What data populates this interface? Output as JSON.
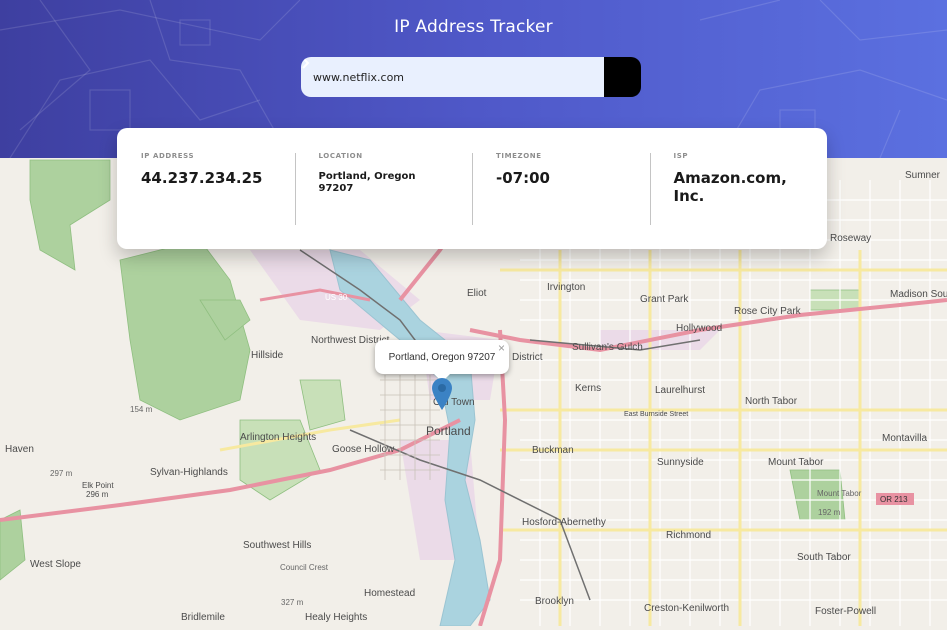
{
  "header": {
    "title": "IP Address Tracker"
  },
  "search": {
    "value": "www.netflix.com",
    "submit_icon": "chevron-right-icon"
  },
  "info": {
    "ip_label": "IP ADDRESS",
    "ip_value": "44.237.234.25",
    "location_label": "LOCATION",
    "location_value": "Portland, Oregon 97207",
    "timezone_label": "TIMEZONE",
    "timezone_value": "-07:00",
    "isp_label": "ISP",
    "isp_value": "Amazon.com, Inc."
  },
  "map": {
    "popup_text": "Portland, Oregon 97207",
    "popup_close": "×",
    "marker_icon": "map-pin-icon",
    "marker_color": "#3b82c4",
    "labels": {
      "sumner": "Sumner",
      "roseway": "Roseway",
      "madison_south": "Madison Sou",
      "us30": "US 30",
      "eliot": "Eliot",
      "irvington": "Irvington",
      "grant_park": "Grant Park",
      "rose_city_park": "Rose City Park",
      "hollywood": "Hollywood",
      "northwest_district": "Northwest District",
      "sullivans_gulch": "Sullivan's Gulch",
      "district": "District",
      "hillside": "Hillside",
      "kerns": "Kerns",
      "laurelhurst": "Laurelhurst",
      "east_burnside": "East Burnside Street",
      "north_tabor": "North Tabor",
      "old_town": "Old Town",
      "portland": "Portland",
      "arlington_heights": "Arlington Heights",
      "goose_hollow": "Goose Hollow",
      "montavilla": "Montavilla",
      "haven": "Haven",
      "sylvan_highlands": "Sylvan-Highlands",
      "buckman": "Buckman",
      "sunnyside": "Sunnyside",
      "mount_tabor": "Mount Tabor",
      "or213": "OR 213",
      "elk_point": "Elk Point",
      "elk_point_elev": "296 m",
      "mount_tabor_peak": "Mount Tabor",
      "mount_tabor_elev": "192 m",
      "hosford": "Hosford-Abernethy",
      "richmond": "Richmond",
      "southwest_hills": "Southwest Hills",
      "west_slope": "West Slope",
      "council_crest": "Council Crest",
      "council_crest_elev": "327 m",
      "homestead": "Homestead",
      "south_tabor": "South Tabor",
      "brooklyn": "Brooklyn",
      "creston": "Creston-Kenilworth",
      "foster_powell": "Foster-Powell",
      "bridlemile": "Bridlemile",
      "healy_heights": "Healy Heights",
      "elev_297": "297 m",
      "elev_154": "154 m"
    }
  }
}
